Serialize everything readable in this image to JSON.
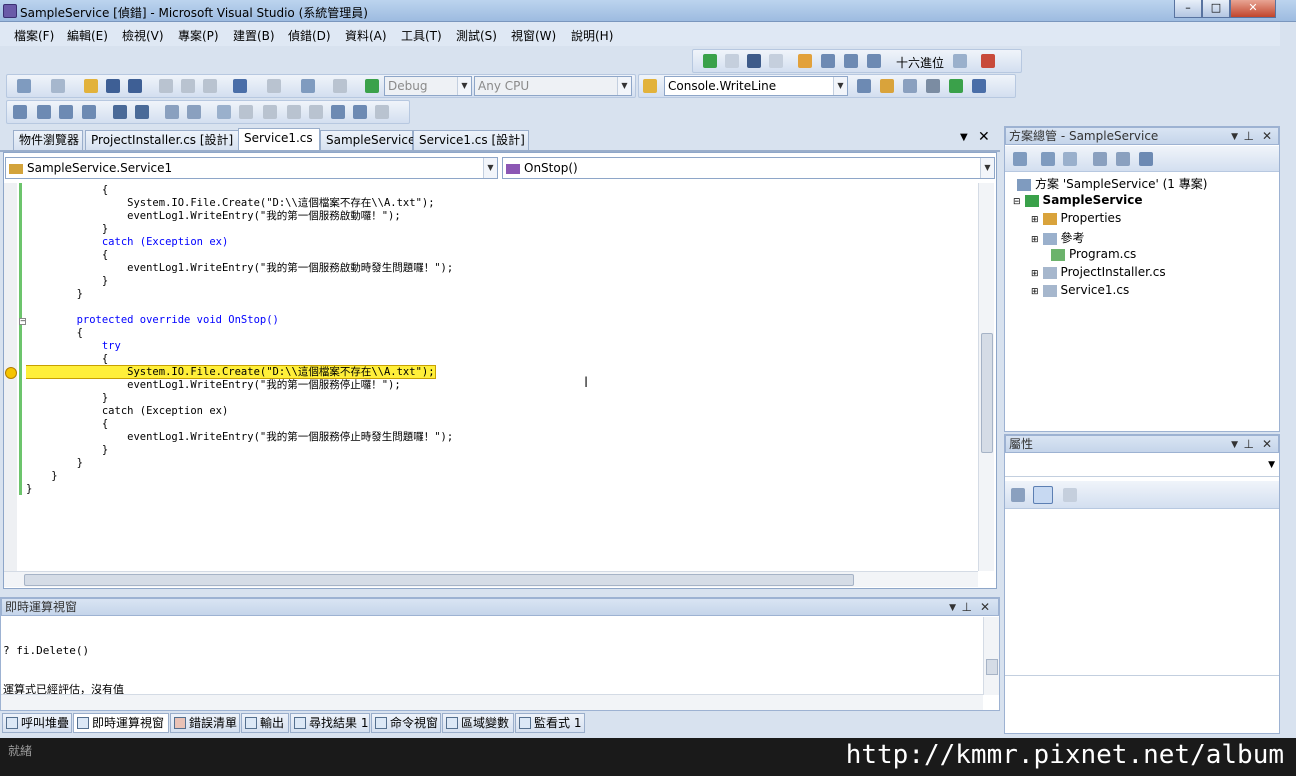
{
  "window": {
    "title": "SampleService [偵錯] - Microsoft Visual Studio (系統管理員)",
    "minimize": "–",
    "maximize": "□",
    "close": "✕"
  },
  "menu": [
    "檔案(F)",
    "編輯(E)",
    "檢視(V)",
    "專案(P)",
    "建置(B)",
    "偵錯(D)",
    "資料(A)",
    "工具(T)",
    "測試(S)",
    "視窗(W)",
    "說明(H)"
  ],
  "toolbar": {
    "config": "Debug",
    "platform": "Any CPU",
    "find": "Console.WriteLine",
    "hex": "十六進位"
  },
  "doc_tabs": [
    "物件瀏覽器",
    "ProjectInstaller.cs [設計]",
    "Service1.cs",
    "SampleService",
    "Service1.cs [設計]"
  ],
  "nav": {
    "type": "SampleService.Service1",
    "member": "OnStop()"
  },
  "code": [
    "            {",
    "                System.IO.File.Create(\"D:\\\\這個檔案不存在\\\\A.txt\");",
    "                eventLog1.WriteEntry(\"我的第一個服務啟動囉！\");",
    "            }",
    "            catch (Exception ex)",
    "            {",
    "                eventLog1.WriteEntry(\"我的第一個服務啟動時發生問題囉！\");",
    "            }",
    "        }",
    "",
    "        protected override void OnStop()",
    "        {",
    "            try",
    "            {",
    "                System.IO.File.Create(\"D:\\\\這個檔案不存在\\\\A.txt\");",
    "                eventLog1.WriteEntry(\"我的第一個服務停止囉！\");",
    "            }",
    "            catch (Exception ex)",
    "            {",
    "                eventLog1.WriteEntry(\"我的第一個服務停止時發生問題囉！\");",
    "            }",
    "        }",
    "    }",
    "}"
  ],
  "solution": {
    "header": "方案總管 - SampleService",
    "root": "方案 'SampleService' (1 專案)",
    "project": "SampleService",
    "items": [
      "Properties",
      "參考",
      "Program.cs",
      "ProjectInstaller.cs",
      "Service1.cs"
    ]
  },
  "properties": {
    "header": "屬性"
  },
  "immediate": {
    "header": "即時運算視窗",
    "lines": [
      "? fi.Delete()",
      "運算式已經評估，沒有值"
    ]
  },
  "bottom_tabs": [
    "呼叫堆疊",
    "即時運算視窗",
    "錯誤清單",
    "輸出",
    "尋找結果 1",
    "命令視窗",
    "區域變數",
    "監看式 1"
  ],
  "status": {
    "left": "就緒"
  },
  "watermark": "http://kmmr.pixnet.net/album"
}
